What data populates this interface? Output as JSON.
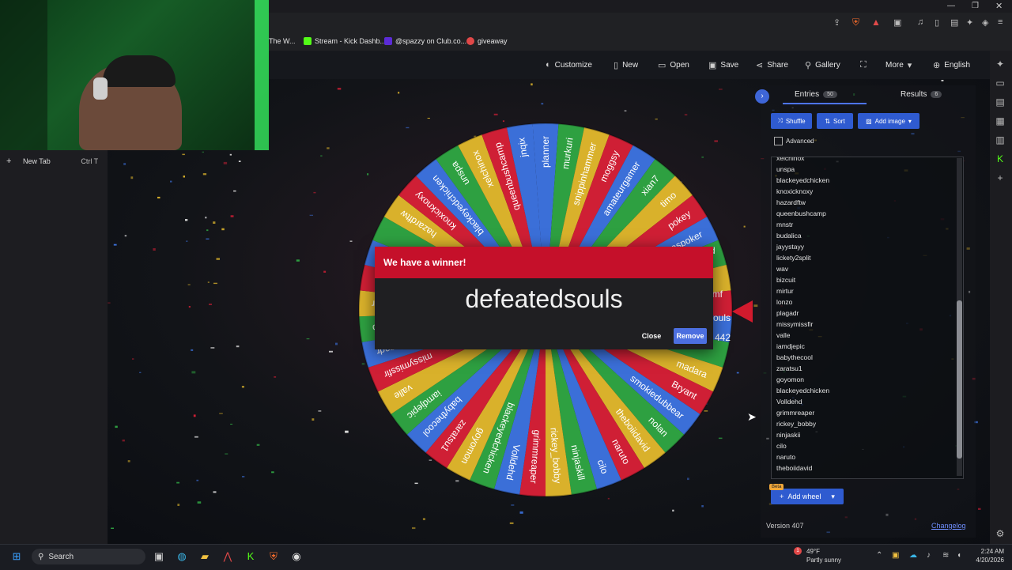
{
  "browser": {
    "bookmarks": [
      {
        "label": "The W...",
        "color": "#e8e8e8"
      },
      {
        "label": "Stream - Kick Dashb...",
        "color": "#53fc18"
      },
      {
        "label": "@spazzy on Club.co...",
        "color": "#5b2bd6"
      },
      {
        "label": "giveaway",
        "color": "#e04848"
      }
    ],
    "new_tab": {
      "label": "New Tab",
      "shortcut": "Ctrl T"
    }
  },
  "app": {
    "toolbar": {
      "customize": "Customize",
      "new": "New",
      "open": "Open",
      "save": "Save",
      "share": "Share",
      "gallery": "Gallery",
      "more": "More",
      "language": "English"
    },
    "wheel": {
      "colors": [
        "#3b6fd8",
        "#2ea041",
        "#d9b12b",
        "#cf1f35"
      ],
      "labels": [
        "planner",
        "murkuri",
        "snippinhammer",
        "moggsy",
        "amateurgamer",
        "xian7",
        "timo",
        "pokey",
        "nbaspoker",
        "jnqix",
        "",
        "",
        "",
        "",
        "madara",
        "Bryant",
        "smokiedubbear",
        "nolan",
        "theboiidavid",
        "naruto",
        "cilo",
        "ninjaskill",
        "rickey_bobby",
        "grimmreaper",
        "Volldehd",
        "blackeyedchicken",
        "goyomon",
        "zaratsu1",
        "babythecool",
        "iamdjepic",
        "valle",
        "missymissfir",
        "plagadr",
        "lonzo",
        "mirtur",
        "",
        "",
        "",
        "hazardftw",
        "knoxicknoxy",
        "blackeyedchicken",
        "unspa",
        "xelchinox",
        "queenbushcamp",
        "jnqix"
      ],
      "partial_labels": [
        "amf",
        "souls",
        "442",
        "d"
      ]
    },
    "dialog": {
      "title": "We have a winner!",
      "winner": "defeatedsouls",
      "close": "Close",
      "remove": "Remove"
    },
    "panel": {
      "tabs": [
        {
          "label": "Entries",
          "count": "50"
        },
        {
          "label": "Results",
          "count": "6"
        }
      ],
      "shuffle": "Shuffle",
      "sort": "Sort",
      "add_image": "Add image",
      "advanced": "Advanced",
      "entries": [
        "xelchinox",
        "unspa",
        "blackeyedchicken",
        "knoxicknoxy",
        "hazardftw",
        "queenbushcamp",
        "mnstr",
        "budalica",
        "jayystayy",
        "lickety2split",
        "wav",
        "bizcuit",
        "mirtur",
        "lonzo",
        "plagadr",
        "missymissfir",
        "valle",
        "iamdjepic",
        "babythecool",
        "zaratsu1",
        "goyomon",
        "blackeyedchicken",
        "Volldehd",
        "grimmreaper",
        "rickey_bobby",
        "ninjaskii",
        "cilo",
        "naruto",
        "theboiidavid"
      ],
      "beta": "Beta",
      "add_wheel": "Add wheel",
      "version": "Version 407",
      "changelog": "Changelog"
    }
  },
  "taskbar": {
    "search": "Search",
    "weather_temp": "49°F",
    "weather_desc": "Partly sunny",
    "weather_badge": "1",
    "time": "2:24 AM",
    "date": "4/20/2026"
  }
}
